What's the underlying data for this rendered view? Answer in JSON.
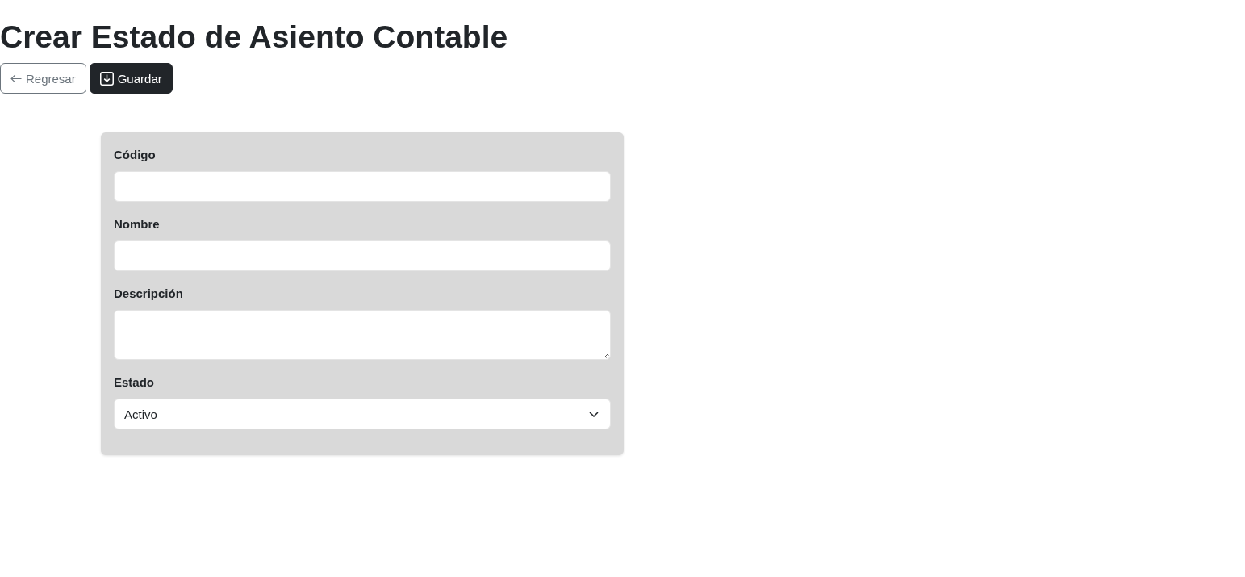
{
  "page": {
    "title": "Crear Estado de Asiento Contable"
  },
  "actions": [
    {
      "kind": "back",
      "label": "Regresar"
    },
    {
      "kind": "save",
      "label": "Guardar"
    }
  ],
  "form": {
    "fields": [
      {
        "kind": "text",
        "label": "Código"
      },
      {
        "kind": "text",
        "label": "Nombre"
      },
      {
        "kind": "textarea",
        "label": "Descripción"
      },
      {
        "kind": "select",
        "label": "Estado",
        "value": "Activo"
      }
    ]
  }
}
